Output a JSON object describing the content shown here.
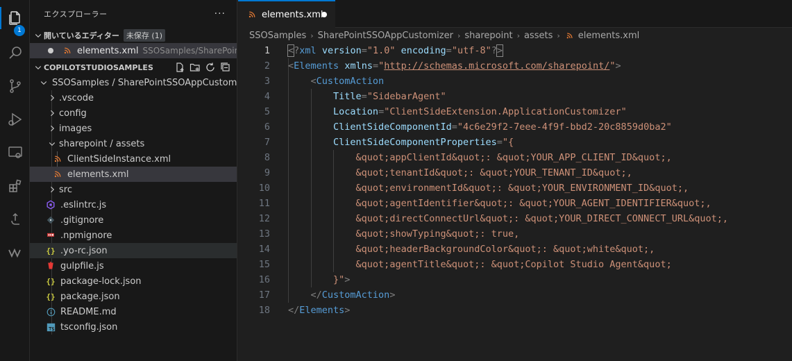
{
  "activity_bar": {
    "explorer_badge": "1"
  },
  "explorer": {
    "title": "エクスプローラー",
    "more_label": "···",
    "open_editors": {
      "header": "開いているエディター",
      "unsaved_badge": "未保存 (1)",
      "items": [
        {
          "name": "elements.xml",
          "description": "SSOSamples/SharePoint..."
        }
      ]
    },
    "workspace": {
      "header": "COPILOTSTUDIOSAMPLES",
      "root_folder": "SSOSamples / SharePointSSOAppCustom...",
      "tree": [
        {
          "label": ".vscode",
          "kind": "folder"
        },
        {
          "label": "config",
          "kind": "folder"
        },
        {
          "label": "images",
          "kind": "folder"
        },
        {
          "label": "sharepoint / assets",
          "kind": "folder-open"
        },
        {
          "label": "ClientSideInstance.xml",
          "kind": "xml"
        },
        {
          "label": "elements.xml",
          "kind": "xml"
        },
        {
          "label": "src",
          "kind": "folder"
        },
        {
          "label": ".eslintrc.js",
          "kind": "eslint"
        },
        {
          "label": ".gitignore",
          "kind": "git"
        },
        {
          "label": ".npmignore",
          "kind": "npm"
        },
        {
          "label": ".yo-rc.json",
          "kind": "json"
        },
        {
          "label": "gulpfile.js",
          "kind": "gulp"
        },
        {
          "label": "package-lock.json",
          "kind": "json"
        },
        {
          "label": "package.json",
          "kind": "json"
        },
        {
          "label": "README.md",
          "kind": "info"
        },
        {
          "label": "tsconfig.json",
          "kind": "ts"
        }
      ]
    }
  },
  "editor": {
    "tab": {
      "label": "elements.xml"
    },
    "breadcrumbs": [
      "SSOSamples",
      "SharePointSSOAppCustomizer",
      "sharepoint",
      "assets",
      "elements.xml"
    ],
    "lines": [
      {
        "n": "1",
        "text": "<?xml version=\"1.0\" encoding=\"utf-8\"?>"
      },
      {
        "n": "2",
        "text": "<Elements xmlns=\"http://schemas.microsoft.com/sharepoint/\">"
      },
      {
        "n": "3",
        "text": "    <CustomAction"
      },
      {
        "n": "4",
        "text": "        Title=\"SidebarAgent\""
      },
      {
        "n": "5",
        "text": "        Location=\"ClientSideExtension.ApplicationCustomizer\""
      },
      {
        "n": "6",
        "text": "        ClientSideComponentId=\"4c6e29f2-7eee-4f9f-bbd2-20c8859d0ba2\""
      },
      {
        "n": "7",
        "text": "        ClientSideComponentProperties=\"{"
      },
      {
        "n": "8",
        "text": "            &quot;appClientId&quot;: &quot;YOUR_APP_CLIENT_ID&quot;,"
      },
      {
        "n": "9",
        "text": "            &quot;tenantId&quot;: &quot;YOUR_TENANT_ID&quot;,"
      },
      {
        "n": "10",
        "text": "            &quot;environmentId&quot;: &quot;YOUR_ENVIRONMENT_ID&quot;,"
      },
      {
        "n": "11",
        "text": "            &quot;agentIdentifier&quot;: &quot;YOUR_AGENT_IDENTIFIER&quot;,"
      },
      {
        "n": "12",
        "text": "            &quot;directConnectUrl&quot;: &quot;YOUR_DIRECT_CONNECT_URL&quot;,"
      },
      {
        "n": "13",
        "text": "            &quot;showTyping&quot;: true,"
      },
      {
        "n": "14",
        "text": "            &quot;headerBackgroundColor&quot;: &quot;white&quot;,"
      },
      {
        "n": "15",
        "text": "            &quot;agentTitle&quot;: &quot;Copilot Studio Agent&quot;"
      },
      {
        "n": "16",
        "text": "        }\">"
      },
      {
        "n": "17",
        "text": "    </CustomAction>"
      },
      {
        "n": "18",
        "text": "</Elements>"
      }
    ]
  }
}
